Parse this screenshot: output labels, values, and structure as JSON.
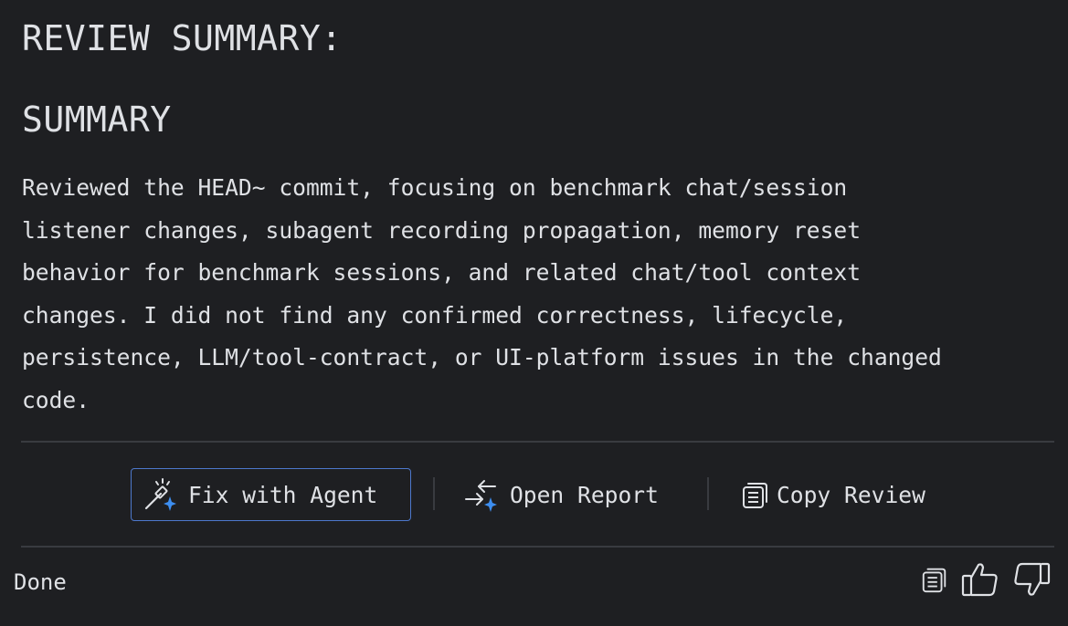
{
  "review": {
    "title": "REVIEW SUMMARY:",
    "summary_heading": "SUMMARY",
    "summary_lines": [
      "Reviewed the HEAD~ commit, focusing on benchmark chat/session",
      "listener changes, subagent recording propagation, memory reset",
      "behavior for benchmark sessions, and related chat/tool context",
      "changes. I did not find any confirmed correctness, lifecycle,",
      "persistence, LLM/tool-contract, or UI-platform issues in the changed",
      "code."
    ]
  },
  "actions": {
    "fix_label": "Fix with Agent",
    "fix_icon": "magic-wand-icon",
    "open_label": "Open Report",
    "open_icon": "open-report-icon",
    "copy_label": "Copy Review",
    "copy_icon": "copy-icon"
  },
  "footer": {
    "status": "Done",
    "icons": [
      "copy-icon",
      "thumbs-up-icon",
      "thumbs-down-icon"
    ]
  },
  "colors": {
    "background": "#1e1f22",
    "text": "#dfe1e5",
    "accent": "#4d78cc",
    "sparkle": "#3d8ef0",
    "divider": "#393b40"
  }
}
